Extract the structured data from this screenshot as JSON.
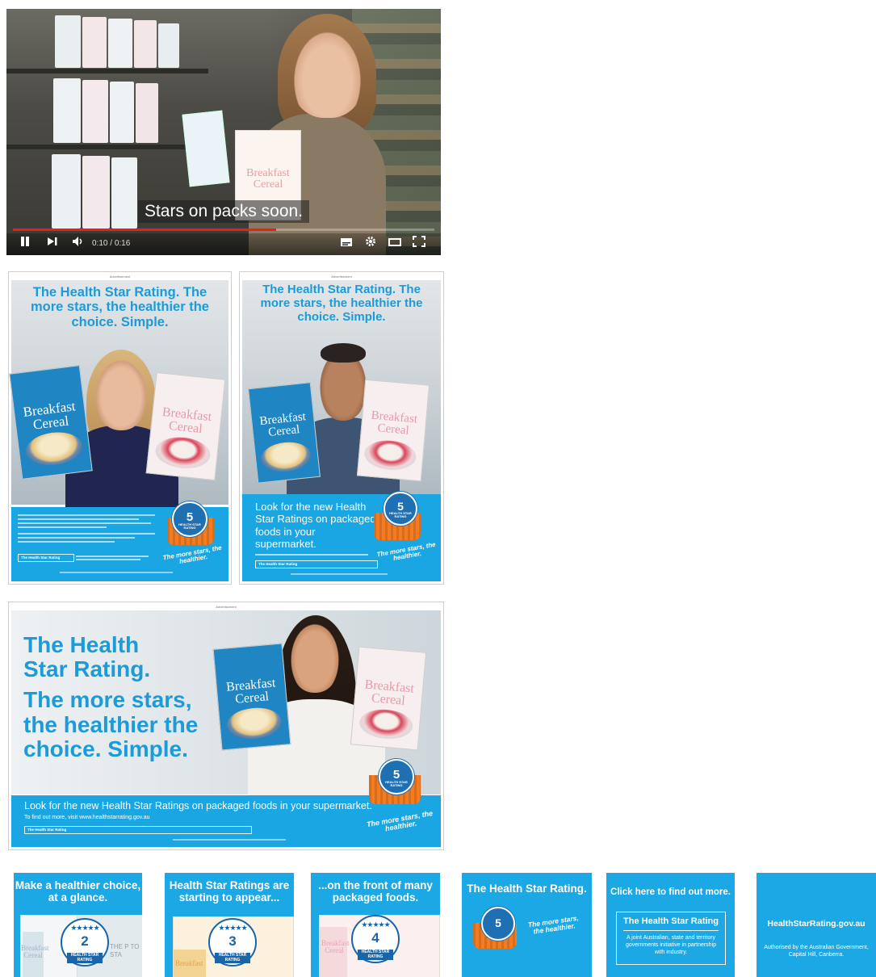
{
  "video": {
    "caption": "Stars on packs soon.",
    "current_time": "0:10",
    "time_separator": " / ",
    "duration": "0:16",
    "progress": 0.625,
    "buffered": 0.62,
    "held_box_title": "Breakfast Cereal",
    "controls": {
      "play_pause": "pause-icon",
      "next": "next-icon",
      "volume": "volume-icon",
      "subtitles": "subtitles-icon",
      "settings": "gear-icon",
      "theater": "theater-icon",
      "fullscreen": "fullscreen-icon"
    }
  },
  "poster_woman_blonde": {
    "ad_label": "Advertisement",
    "headline": "The Health Star Rating. The more stars, the healthier the choice. Simple.",
    "box_left": "Breakfast Cereal",
    "box_right": "Breakfast Cereal",
    "badge_number": "5",
    "badge_label": "HEALTH STAR RATING",
    "slogan": "The more stars, the healthier.",
    "footer_button": "The Health Star Rating"
  },
  "poster_man": {
    "ad_label": "Advertisement",
    "headline": "The Health Star Rating. The more stars, the healthier the choice. Simple.",
    "box_left": "Breakfast Cereal",
    "box_right": "Breakfast Cereal",
    "body": "Look for the new Health Star Ratings on packaged foods in your supermarket.",
    "badge_number": "5",
    "badge_label": "HEALTH STAR RATING",
    "slogan": "The more stars, the healthier.",
    "footer_button": "The Health Star Rating"
  },
  "poster_landscape": {
    "ad_label": "Advertisement",
    "headline_line1": "The Health",
    "headline_line2": "Star Rating.",
    "headline_line3": "The more stars,",
    "headline_line4": "the healthier the",
    "headline_line5": "choice. Simple.",
    "box_left": "Breakfast Cereal",
    "box_right": "Breakfast Cereal",
    "body": "Look for the new Health Star Ratings on packaged foods in your supermarket.",
    "sub": "To find out more, visit www.healthstarrating.gov.au",
    "badge_number": "5",
    "badge_label": "HEALTH STAR RATING",
    "slogan": "The more stars, the healthier.",
    "footer_button": "The Health Star Rating"
  },
  "banners": [
    {
      "text": "Make a healthier choice, at a glance.",
      "rating": "2",
      "rating_label": "HEALTH STAR RATING",
      "pack_text": "THE P TO STA",
      "pack_brand": "Breakfast Cereal"
    },
    {
      "text": "Health Star Ratings are starting to appear...",
      "rating": "3",
      "rating_label": "HEALTH STAR RATING",
      "pack_brand": "Breakfast"
    },
    {
      "text": "...on the front of many packaged foods.",
      "rating": "4",
      "rating_label": "HEALTH STAR RATING",
      "pack_brand": "Breakfast Cereal"
    },
    {
      "text": "The Health Star Rating.",
      "rating": "5",
      "slogan": "The more stars, the healthier."
    },
    {
      "text": "Click here to find out more.",
      "box_title": "The Health Star Rating",
      "box_body": "A joint Australian, state and territory governments initiative in partnership with industry."
    },
    {
      "text": "HealthStarRating.gov.au",
      "footer": "Authorised by the Australian Government, Capital Hill, Canberra."
    }
  ],
  "colors": {
    "brand_blue": "#1ba8e4",
    "headline_blue": "#1b9bd7",
    "badge_navy": "#1a64a8",
    "basket_orange": "#f47b20",
    "progress_red": "#e62117"
  }
}
